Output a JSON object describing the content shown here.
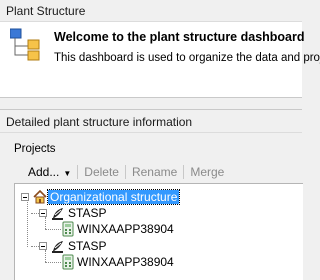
{
  "panel_top": {
    "header": "Plant Structure",
    "welcome_title": "Welcome to the plant structure dashboard",
    "welcome_desc": "This dashboard is used to organize the data and proje"
  },
  "panel_detail": {
    "header": "Detailed plant structure information",
    "group_label": "Projects",
    "toolbar": {
      "add": "Add...",
      "delete": "Delete",
      "rename": "Rename",
      "merge": "Merge"
    },
    "tree": {
      "root": "Organizational structure",
      "nodes": [
        {
          "label": "STASP",
          "child": "WINXAAPP38904"
        },
        {
          "label": "STASP",
          "child": "WINXAAPP38904"
        }
      ]
    }
  },
  "colors": {
    "selection": "#3399ff",
    "disabled_text": "#8a8a8a",
    "panel_bg": "#f0f0f0"
  }
}
